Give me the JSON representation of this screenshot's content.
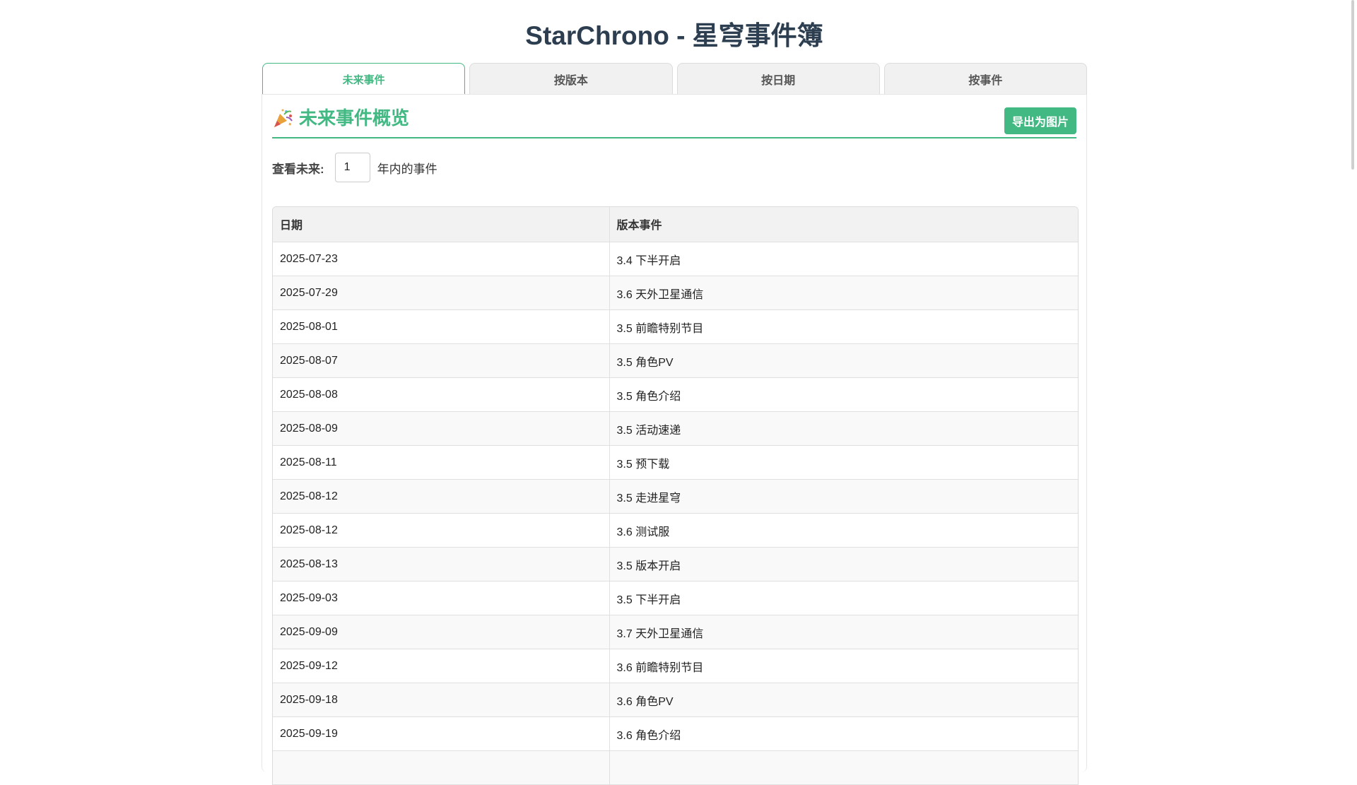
{
  "app": {
    "title": "StarChrono - 星穹事件簿"
  },
  "tabs": [
    {
      "label": "未来事件",
      "active": true
    },
    {
      "label": "按版本",
      "active": false
    },
    {
      "label": "按日期",
      "active": false
    },
    {
      "label": "按事件",
      "active": false
    }
  ],
  "panel": {
    "title": "未来事件概览",
    "icon": "party-popper-icon",
    "export_label": "导出为图片"
  },
  "filter": {
    "label": "查看未来:",
    "years_value": "1",
    "suffix": "年内的事件"
  },
  "table": {
    "columns": [
      "日期",
      "版本事件"
    ],
    "rows": [
      {
        "date": "2025-07-23",
        "event": "3.4 下半开启"
      },
      {
        "date": "2025-07-29",
        "event": "3.6 天外卫星通信"
      },
      {
        "date": "2025-08-01",
        "event": "3.5 前瞻特别节目"
      },
      {
        "date": "2025-08-07",
        "event": "3.5 角色PV"
      },
      {
        "date": "2025-08-08",
        "event": "3.5 角色介绍"
      },
      {
        "date": "2025-08-09",
        "event": "3.5 活动速递"
      },
      {
        "date": "2025-08-11",
        "event": "3.5 预下载"
      },
      {
        "date": "2025-08-12",
        "event": "3.5 走进星穹"
      },
      {
        "date": "2025-08-12",
        "event": "3.6 测试服"
      },
      {
        "date": "2025-08-13",
        "event": "3.5 版本开启"
      },
      {
        "date": "2025-09-03",
        "event": "3.5 下半开启"
      },
      {
        "date": "2025-09-09",
        "event": "3.7 天外卫星通信"
      },
      {
        "date": "2025-09-12",
        "event": "3.6 前瞻特别节目"
      },
      {
        "date": "2025-09-18",
        "event": "3.6 角色PV"
      },
      {
        "date": "2025-09-19",
        "event": "3.6 角色介绍"
      },
      {
        "date": "",
        "event": ""
      }
    ]
  },
  "colors": {
    "accent": "#42b883",
    "title": "#2c3e50"
  }
}
